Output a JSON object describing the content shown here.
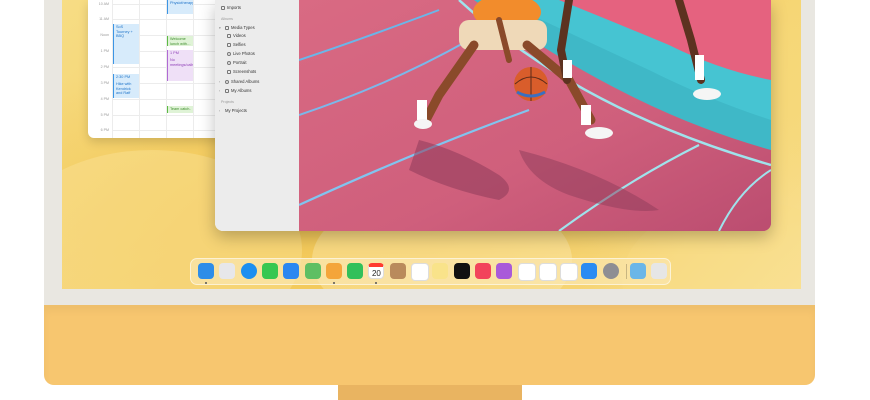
{
  "calendar": {
    "times": [
      "10 AM",
      "11 AM",
      "Noon",
      "1 PM",
      "2 PM",
      "3 PM",
      "4 PM",
      "5 PM",
      "6 PM"
    ],
    "events": [
      {
        "text": "Physiotherapy",
        "color": "blue"
      },
      {
        "text": "SoS Tourney + BBQ",
        "color": "blue"
      },
      {
        "text": "Welcome lunch with…",
        "color": "green"
      },
      {
        "text": "1 PM",
        "color": "purple"
      },
      {
        "text": "No meetings/calls",
        "color": "purple"
      },
      {
        "text": "2:30 PM",
        "color": "blue"
      },
      {
        "text": "Hike with Kendrick and Raff",
        "color": "blue"
      },
      {
        "text": "Team catch-up",
        "color": "green"
      }
    ]
  },
  "photos_sidebar": {
    "items_top": [
      {
        "label": "Imports",
        "icon": "import-icon"
      }
    ],
    "albums_header": "Albums",
    "media_types": {
      "label": "Media Types",
      "icon": "folder-icon"
    },
    "media_children": [
      {
        "label": "Videos",
        "icon": "video-icon"
      },
      {
        "label": "Selfies",
        "icon": "selfie-icon"
      },
      {
        "label": "Live Photos",
        "icon": "live-photo-icon"
      },
      {
        "label": "Portrait",
        "icon": "portrait-icon"
      },
      {
        "label": "Screenshots",
        "icon": "screenshot-icon"
      }
    ],
    "shared_albums": "Shared Albums",
    "my_albums": "My Albums",
    "projects_header": "Projects",
    "my_projects": "My Projects"
  },
  "dock": {
    "apps": [
      {
        "name": "finder-icon",
        "color": "#2e8de8",
        "running": true
      },
      {
        "name": "launchpad-icon",
        "color": "#e7e7ea",
        "running": false
      },
      {
        "name": "safari-icon",
        "color": "#1c8ff0",
        "running": false
      },
      {
        "name": "messages-icon",
        "color": "#37c751",
        "running": false
      },
      {
        "name": "mail-icon",
        "color": "#2b87f0",
        "running": false
      },
      {
        "name": "maps-icon",
        "color": "#5fbf63",
        "running": false
      },
      {
        "name": "photos-icon",
        "color": "#f4a53a",
        "running": true
      },
      {
        "name": "facetime-icon",
        "color": "#32c05a",
        "running": false
      },
      {
        "name": "calendar-icon",
        "color": "#ffffff",
        "running": true,
        "label": "20"
      },
      {
        "name": "contacts-icon",
        "color": "#b98a5c",
        "running": false
      },
      {
        "name": "reminders-icon",
        "color": "#ffffff",
        "running": false
      },
      {
        "name": "notes-icon",
        "color": "#f9e38a",
        "running": false
      },
      {
        "name": "tv-icon",
        "color": "#111111",
        "running": false
      },
      {
        "name": "music-icon",
        "color": "#f2435b",
        "running": false
      },
      {
        "name": "podcasts-icon",
        "color": "#a95ad9",
        "running": false
      },
      {
        "name": "keynote-icon",
        "color": "#ffffff",
        "running": false
      },
      {
        "name": "numbers-icon",
        "color": "#ffffff",
        "running": false
      },
      {
        "name": "pages-icon",
        "color": "#ffffff",
        "running": false
      },
      {
        "name": "app-store-icon",
        "color": "#2a8bf2",
        "running": false
      },
      {
        "name": "system-preferences-icon",
        "color": "#8e8e93",
        "running": false
      },
      {
        "name": "downloads-folder-icon",
        "color": "#6bb6e8",
        "running": false
      },
      {
        "name": "trash-icon",
        "color": "#e6e6e6",
        "running": false
      }
    ]
  }
}
